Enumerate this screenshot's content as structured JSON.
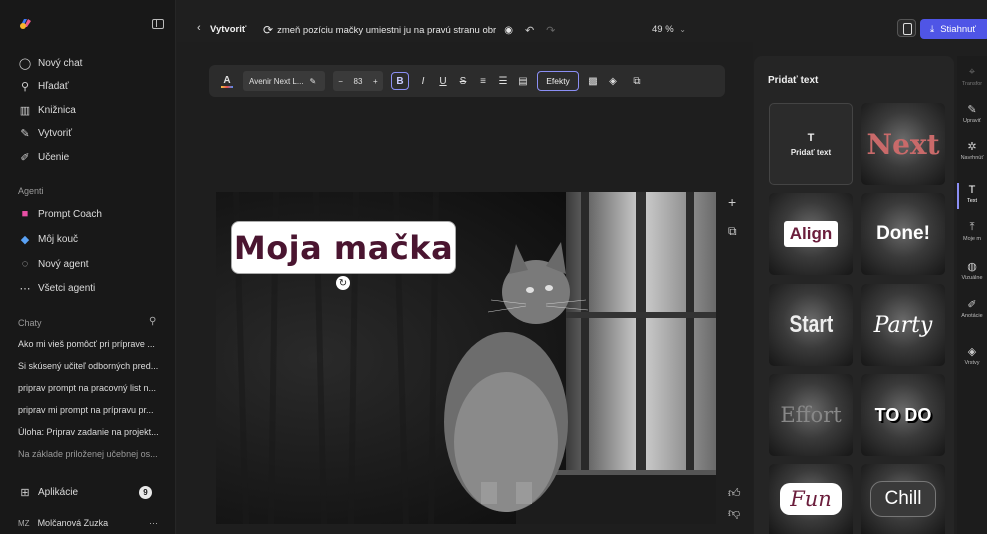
{
  "sidebar": {
    "nav": [
      {
        "label": "Nový chat",
        "icon": "chat-bubble-icon"
      },
      {
        "label": "Hľadať",
        "icon": "search-icon"
      },
      {
        "label": "Knižnica",
        "icon": "library-icon"
      },
      {
        "label": "Vytvoriť",
        "icon": "create-icon"
      },
      {
        "label": "Učenie",
        "icon": "learning-icon"
      }
    ],
    "agents_label": "Agenti",
    "agents": [
      {
        "label": "Prompt Coach",
        "icon": "prompt-coach-icon"
      },
      {
        "label": "Môj kouč",
        "icon": "coach-icon"
      },
      {
        "label": "Nový agent",
        "icon": "new-agent-icon"
      },
      {
        "label": "Všetci agenti",
        "icon": "more-icon"
      }
    ],
    "chats_label": "Chaty",
    "chats": [
      "Ako mi vieš pomôcť pri príprave ...",
      "Si skúsený učiteľ odborných pred...",
      "priprav prompt na pracovný list n...",
      "priprav mi prompt na prípravu pr...",
      "Úloha: Priprav zadanie na projekt...",
      "Na základe priloženej učebnej os..."
    ],
    "apps_label": "Aplikácie",
    "apps_count": "9",
    "user_initials": "MZ",
    "user_name": "Molčanová Zuzka",
    "more": "···"
  },
  "topbar": {
    "back": "‹",
    "title": "Vytvoriť",
    "prompt": "zmeň pozíciu mačky umiestni ju na pravú stranu obr",
    "zoom": "49 %",
    "download_label": "Stiahnuť"
  },
  "toolbar": {
    "font_name": "Avenir Next L...",
    "font_size": "83",
    "minus": "−",
    "plus": "+",
    "bold": "B",
    "italic": "I",
    "underline": "U",
    "strike": "S",
    "effects": "Efekty"
  },
  "canvas": {
    "text": "Moja mačka"
  },
  "panel": {
    "title": "Pridať text",
    "add_tile": "Pridať text",
    "styles": [
      "Next",
      "Align",
      "Done!",
      "Start",
      "Party",
      "Effort",
      "TO DO",
      "Fun",
      "Chill"
    ]
  },
  "rail": [
    {
      "label": "Transfor",
      "icon": "transform-icon"
    },
    {
      "label": "Upraviť",
      "icon": "edit-icon"
    },
    {
      "label": "Navrhnúť",
      "icon": "design-icon"
    },
    {
      "label": "Text",
      "icon": "text-icon"
    },
    {
      "label": "Moje m",
      "icon": "upload-icon"
    },
    {
      "label": "Vizuálne",
      "icon": "visuals-icon"
    },
    {
      "label": "Anotácie",
      "icon": "annotate-icon"
    },
    {
      "label": "Vrstvy",
      "icon": "layers-icon"
    }
  ],
  "colors": {
    "accent": "#4f55e6",
    "text_color": "#4a1530"
  }
}
